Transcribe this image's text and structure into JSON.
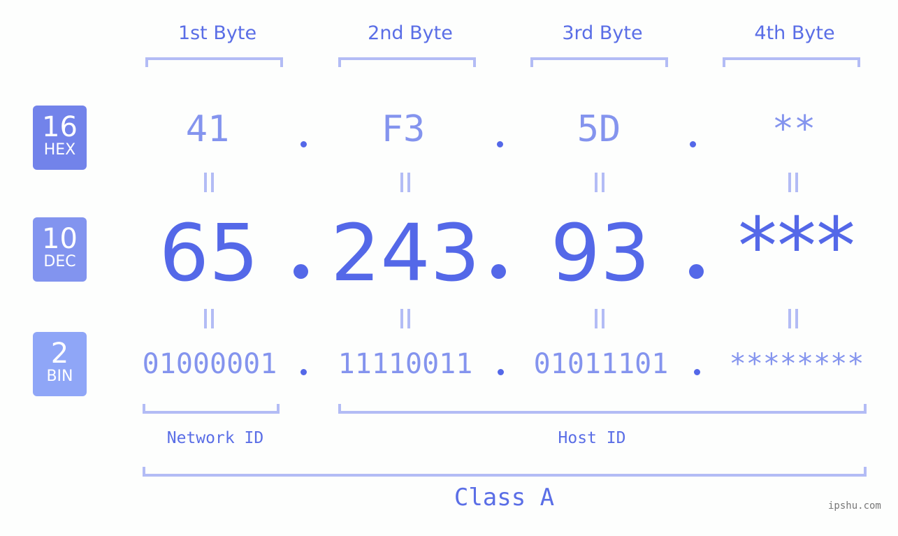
{
  "bytes": {
    "headers": [
      "1st Byte",
      "2nd Byte",
      "3rd Byte",
      "4th Byte"
    ]
  },
  "badges": {
    "hex": {
      "num": "16",
      "label": "HEX",
      "color": "#7283ea"
    },
    "dec": {
      "num": "10",
      "label": "DEC",
      "color": "#8294ef"
    },
    "bin": {
      "num": "2",
      "label": "BIN",
      "color": "#8fa6f7"
    }
  },
  "values": {
    "hex": [
      "41",
      "F3",
      "5D",
      "**"
    ],
    "dec": [
      "65",
      "243",
      "93",
      "***"
    ],
    "bin": [
      "01000001",
      "11110011",
      "01011101",
      "********"
    ]
  },
  "separator": ".",
  "labels": {
    "network": "Network ID",
    "host": "Host ID",
    "class": "Class A"
  },
  "watermark": "ipshu.com",
  "colors": {
    "accent": "#5468e8",
    "light": "#8494ee",
    "bracket": "#b3bcf5"
  }
}
